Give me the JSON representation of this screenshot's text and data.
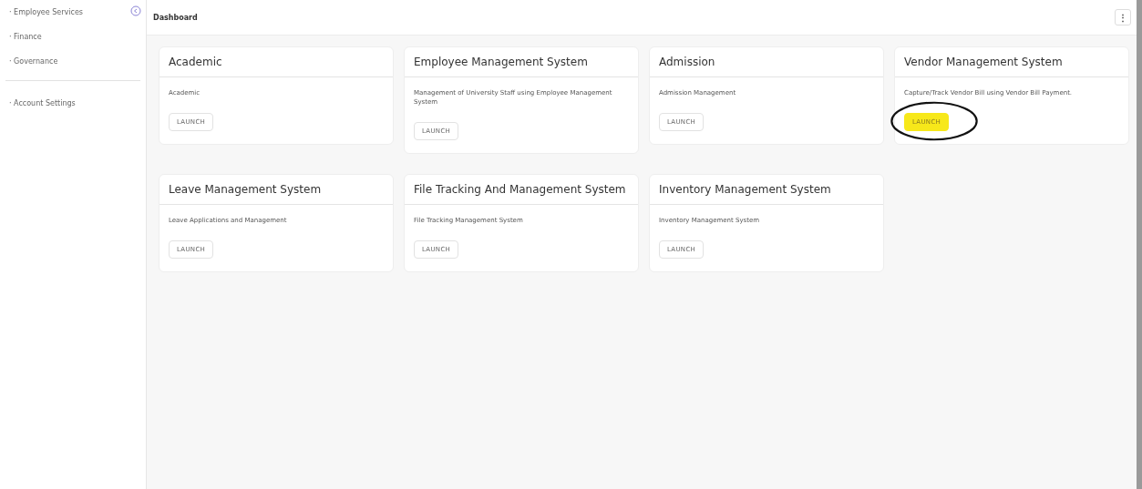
{
  "sidebar": {
    "sections": [
      {
        "items": [
          {
            "label": "· Employee Services"
          },
          {
            "label": "· Finance"
          },
          {
            "label": "· Governance"
          }
        ]
      },
      {
        "items": [
          {
            "label": "· Account Settings"
          }
        ]
      }
    ]
  },
  "header": {
    "title": "Dashboard",
    "menu_button": "⋮"
  },
  "cards": [
    {
      "title": "Academic",
      "description": "Academic",
      "button": "LAUNCH",
      "highlighted": false
    },
    {
      "title": "Employee Management System",
      "description": "Management of University Staff using Employee Management System",
      "button": "LAUNCH",
      "highlighted": false
    },
    {
      "title": "Admission",
      "description": "Admission Management",
      "button": "LAUNCH",
      "highlighted": false
    },
    {
      "title": "Vendor Management System",
      "description": "Capture/Track Vendor Bill using Vendor Bill Payment.",
      "button": "LAUNCH",
      "highlighted": true
    },
    {
      "title": "Leave Management System",
      "description": "Leave Applications and Management",
      "button": "LAUNCH",
      "highlighted": false
    },
    {
      "title": "File Tracking And Management System",
      "description": "File Tracking Management System",
      "button": "LAUNCH",
      "highlighted": false
    },
    {
      "title": "Inventory Management System",
      "description": "Inventory Management System",
      "button": "LAUNCH",
      "highlighted": false
    }
  ]
}
